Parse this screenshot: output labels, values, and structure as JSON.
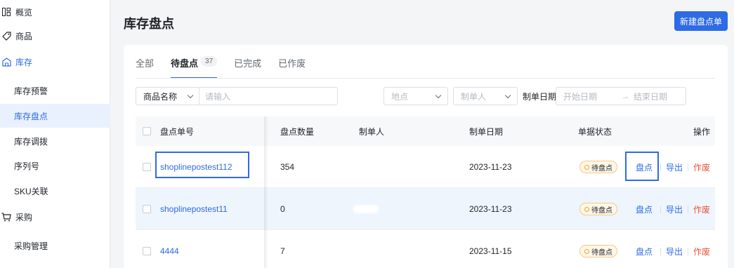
{
  "sidebar": {
    "items": [
      {
        "label": "概览"
      },
      {
        "label": "商品"
      },
      {
        "label": "库存"
      },
      {
        "label": "库存预警"
      },
      {
        "label": "库存盘点"
      },
      {
        "label": "库存调拨"
      },
      {
        "label": "序列号"
      },
      {
        "label": "SKU关联"
      },
      {
        "label": "采购"
      },
      {
        "label": "采购管理"
      }
    ]
  },
  "header": {
    "title": "库存盘点",
    "new_button": "新建盘点单"
  },
  "tabs": [
    {
      "label": "全部"
    },
    {
      "label": "待盘点",
      "count": "37"
    },
    {
      "label": "已完成"
    },
    {
      "label": "已作废"
    }
  ],
  "filters": {
    "product_field": "商品名称",
    "product_placeholder": "请输入",
    "location_placeholder": "地点",
    "creator_placeholder": "制单人",
    "date_label": "制单日期",
    "start_date_placeholder": "开始日期",
    "end_date_placeholder": "结束日期",
    "arrow": "→"
  },
  "table": {
    "columns": [
      "盘点单号",
      "盘点数量",
      "制单人",
      "制单日期",
      "单据状态",
      "操作"
    ],
    "rows": [
      {
        "id": "shoplinepostest112",
        "qty": "354",
        "date": "2023-11-23",
        "status": "待盘点",
        "actions": [
          "盘点",
          "导出",
          "作废"
        ]
      },
      {
        "id": "shoplinepostest11",
        "qty": "0",
        "date": "2023-11-23",
        "status": "待盘点",
        "actions": [
          "盘点",
          "导出",
          "作废"
        ]
      },
      {
        "id": "4444",
        "qty": "7",
        "date": "2023-11-15",
        "status": "待盘点",
        "actions": [
          "盘点",
          "导出",
          "作废"
        ]
      }
    ]
  },
  "colors": {
    "accent": "#2e6be6",
    "danger": "#e8553e",
    "warning": "#f5a623"
  }
}
